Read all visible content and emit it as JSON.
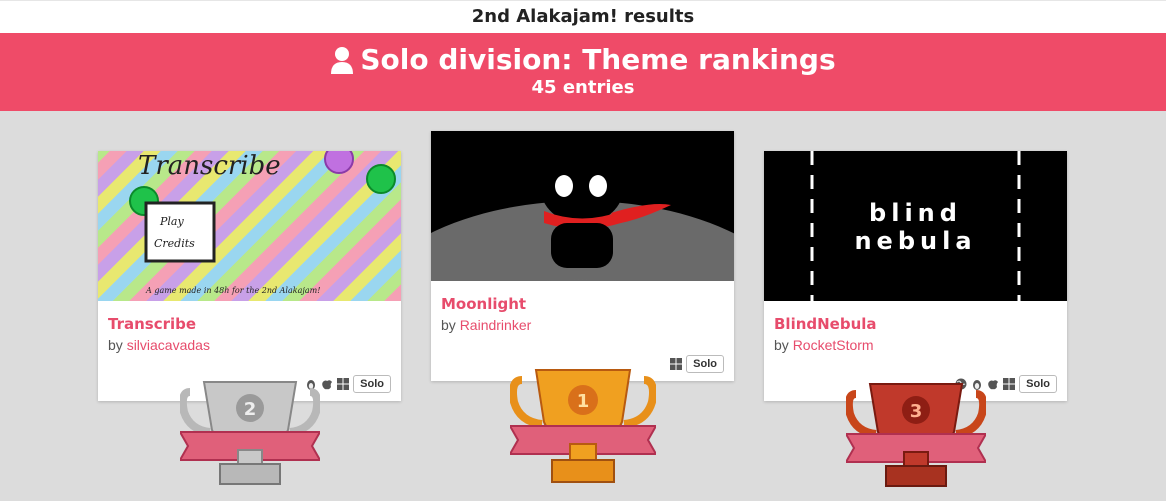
{
  "header": {
    "title": "2nd Alakajam! results"
  },
  "banner": {
    "title": "Solo division:  Theme rankings",
    "subtitle": "45 entries",
    "icon": "user-icon",
    "color": "#ef4b68"
  },
  "entries": [
    {
      "name": "Transcribe",
      "by": "by",
      "author": "silviacavadas",
      "rank": "2",
      "division": "Solo",
      "platforms": [
        "linux-icon",
        "apple-icon",
        "windows-icon"
      ],
      "thumb": {
        "title": "Transcribe",
        "menu1": "Play",
        "menu2": "Credits",
        "tagline": "A game made in 48h for the 2nd Alakajam!"
      }
    },
    {
      "name": "Moonlight",
      "by": "by",
      "author": "Raindrinker",
      "rank": "1",
      "division": "Solo",
      "platforms": [
        "windows-icon"
      ]
    },
    {
      "name": "BlindNebula",
      "by": "by",
      "author": "RocketStorm",
      "rank": "3",
      "division": "Solo",
      "platforms": [
        "web-icon",
        "linux-icon",
        "apple-icon",
        "windows-icon"
      ],
      "thumb": {
        "line1": "blind",
        "line2": "nebula"
      }
    }
  ],
  "colors": {
    "accent": "#e74c6c",
    "background": "#dcdcdc",
    "gold": "#f0a020",
    "silver": "#c8c8c8",
    "bronze": "#c0392b"
  }
}
